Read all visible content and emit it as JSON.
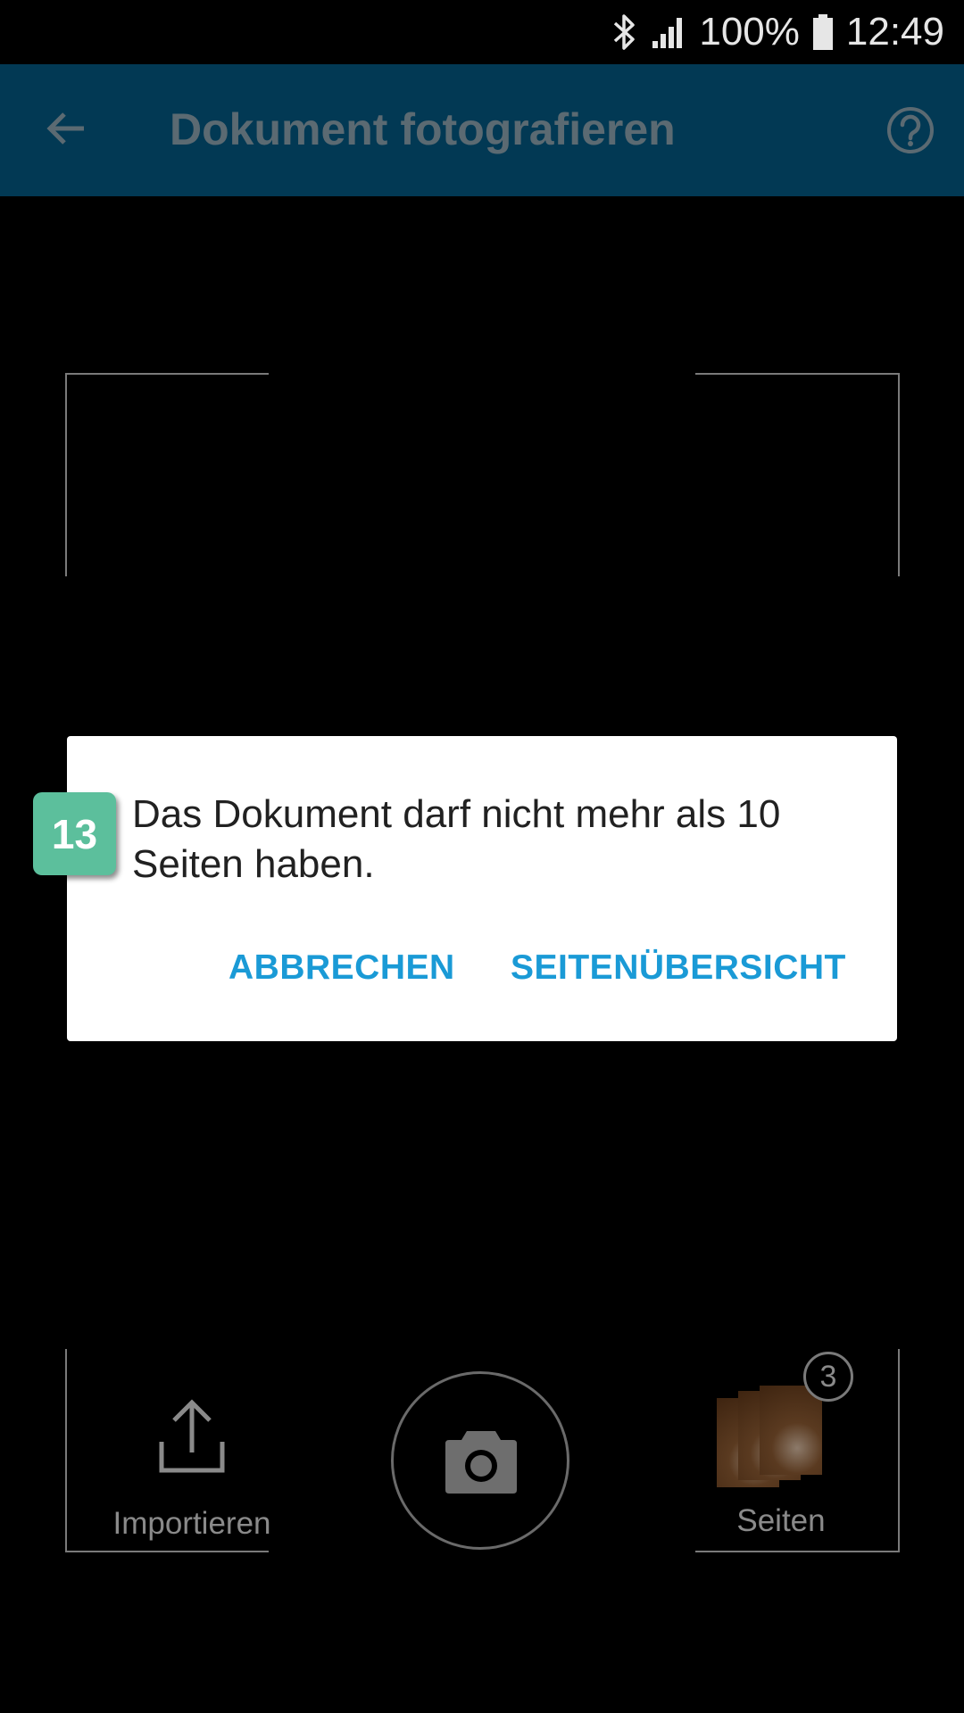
{
  "status_bar": {
    "battery": "100%",
    "time": "12:49",
    "icons": [
      "bluetooth-icon",
      "signal-icon",
      "battery-icon"
    ]
  },
  "app_bar": {
    "title": "Dokument fotografieren",
    "back_icon": "arrow-back-icon",
    "help_icon": "help-circle-icon"
  },
  "dialog": {
    "message": "Das Dokument darf nicht mehr als 10 Seiten haben.",
    "cancel_label": "ABBRECHEN",
    "overview_label": "SEITENÜBERSICHT"
  },
  "step_badge": "13",
  "bottom": {
    "import_label": "Importieren",
    "pages_label": "Seiten",
    "pages_count": "3",
    "camera_icon": "camera-icon",
    "upload_icon": "upload-icon"
  },
  "colors": {
    "app_bar": "#023954",
    "accent": "#1a9ad6",
    "badge": "#5cbf9c"
  }
}
